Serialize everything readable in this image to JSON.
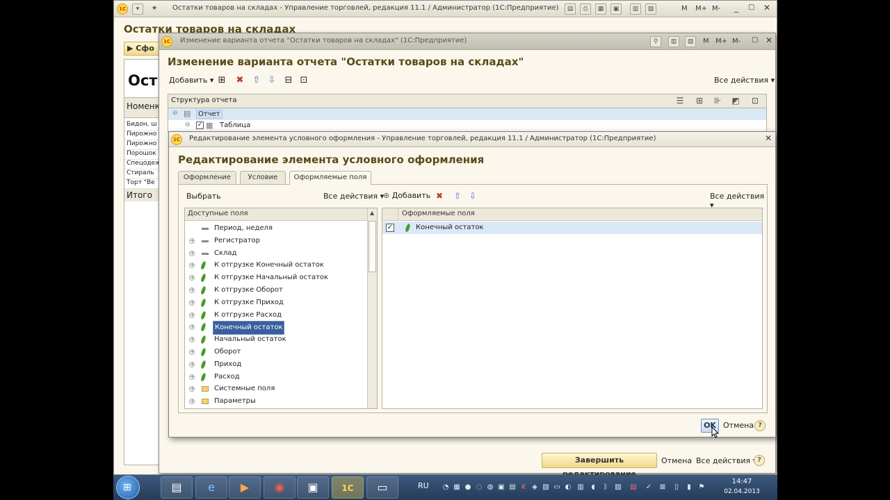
{
  "main_window": {
    "title": "Остатки товаров на складах - Управление торговлей, редакция 11.1 / Администратор  (1С:Предприятие)",
    "heading": "Остатки товаров на складах",
    "form_button": "Сфо",
    "report_title_fragment": "Ост",
    "column_header": "Номенк",
    "rows": [
      "Бидон, ш",
      "Пирожно",
      "Пирожно",
      "Порошок",
      "Спецодеж",
      "Стираль",
      "Торт \"Ве"
    ],
    "total_label": "Итого",
    "title_buttons": [
      "M",
      "M+",
      "M-"
    ]
  },
  "variant_window": {
    "title": "Изменение варианта отчета \"Остатки товаров на складах\"  (1С:Предприятие)",
    "heading": "Изменение варианта отчета \"Остатки товаров на складах\"",
    "add_label": "Добавить",
    "all_actions": "Все действия",
    "structure_header": "Структура отчета",
    "structure_rows": [
      "Отчет",
      "Таблица"
    ],
    "finish_button": "Завершить редактирование",
    "cancel_label": "Отмена",
    "all_actions_bottom": "Все действия",
    "title_buttons": [
      "M",
      "M+",
      "M-"
    ]
  },
  "dialog": {
    "title": "Редактирование элемента условного оформления - Управление торговлей, редакция 11.1 / Администратор  (1С:Предприятие)",
    "heading": "Редактирование элемента условного оформления",
    "tabs": [
      "Оформление",
      "Условие",
      "Оформляемые поля"
    ],
    "active_tab": "Оформляемые поля",
    "select_label": "Выбрать",
    "left_all_actions": "Все действия",
    "add_label": "Добавить",
    "right_all_actions": "Все действия",
    "available_header": "Доступные поля",
    "available_fields": [
      {
        "label": "Период, неделя",
        "icon": "dimension-icon",
        "expandable": false
      },
      {
        "label": "Регистратор",
        "icon": "dimension-icon",
        "expandable": true
      },
      {
        "label": "Склад",
        "icon": "dimension-icon",
        "expandable": true
      },
      {
        "label": "К отгрузке Конечный остаток",
        "icon": "resource-icon",
        "expandable": true
      },
      {
        "label": "К отгрузке Начальный остаток",
        "icon": "resource-icon",
        "expandable": true
      },
      {
        "label": "К отгрузке Оборот",
        "icon": "resource-icon",
        "expandable": true
      },
      {
        "label": "К отгрузке Приход",
        "icon": "resource-icon",
        "expandable": true
      },
      {
        "label": "К отгрузке Расход",
        "icon": "resource-icon",
        "expandable": true
      },
      {
        "label": "Конечный остаток",
        "icon": "resource-icon",
        "expandable": true
      },
      {
        "label": "Начальный остаток",
        "icon": "resource-icon",
        "expandable": true
      },
      {
        "label": "Оборот",
        "icon": "resource-icon",
        "expandable": true
      },
      {
        "label": "Приход",
        "icon": "resource-icon",
        "expandable": true
      },
      {
        "label": "Расход",
        "icon": "resource-icon",
        "expandable": true
      },
      {
        "label": "Системные поля",
        "icon": "folder-icon",
        "expandable": true
      },
      {
        "label": "Параметры",
        "icon": "folder-icon",
        "expandable": true
      }
    ],
    "selected_available": "Конечный остаток",
    "formatted_header": "Оформляемые поля",
    "formatted_fields": [
      {
        "label": "Конечный остаток",
        "checked": true
      }
    ],
    "ok_label": "OK",
    "cancel_label": "Отмена"
  },
  "taskbar": {
    "language": "RU",
    "time": "14:47",
    "date": "02.04.2013"
  },
  "colors": {
    "window_bg": "#fbf7ec",
    "heading": "#5a4a1a",
    "selection": "#3a5fa0",
    "row_highlight": "#dbe8f6",
    "taskbar": "#2f4a6b"
  }
}
